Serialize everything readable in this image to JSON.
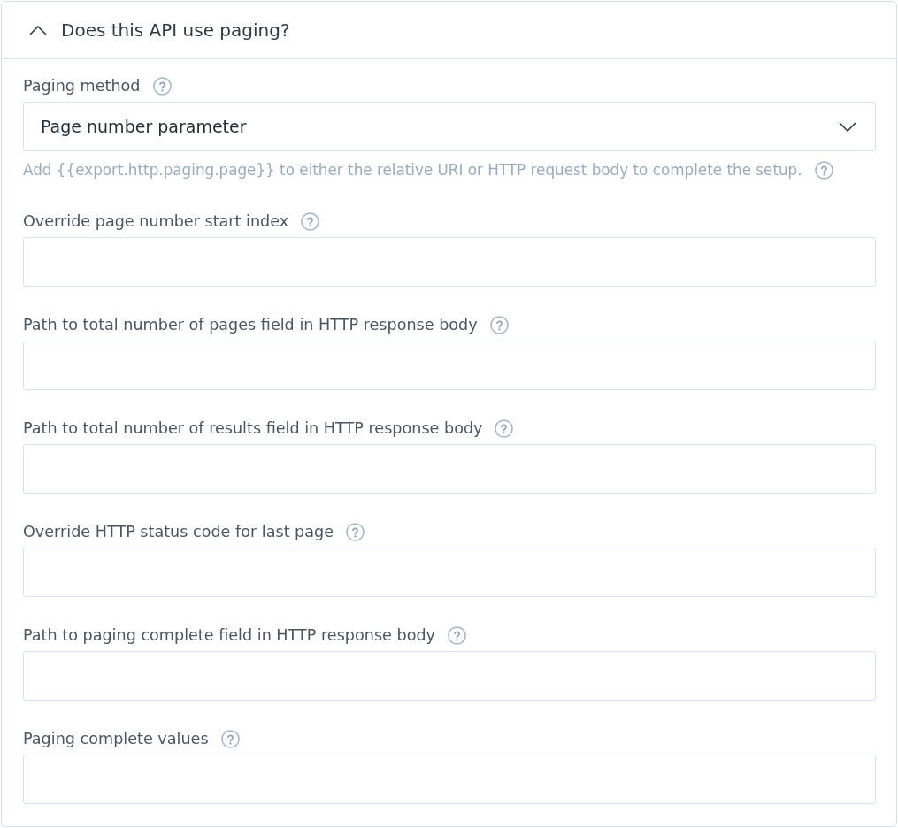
{
  "section": {
    "title": "Does this API use paging?",
    "expanded": true
  },
  "fields": [
    {
      "kind": "select",
      "label": "Paging method",
      "value": "Page number parameter",
      "hint": "Add {{export.http.paging.page}} to either the relative URI or HTTP request body to complete the setup."
    },
    {
      "kind": "text",
      "label": "Override page number start index"
    },
    {
      "kind": "text",
      "label": "Path to total number of pages field in HTTP response body"
    },
    {
      "kind": "text",
      "label": "Path to total number of results field in HTTP response body"
    },
    {
      "kind": "text",
      "label": "Override HTTP status code for last page"
    },
    {
      "kind": "text",
      "label": "Path to paging complete field in HTTP response body"
    },
    {
      "kind": "text",
      "label": "Paging complete values"
    }
  ]
}
